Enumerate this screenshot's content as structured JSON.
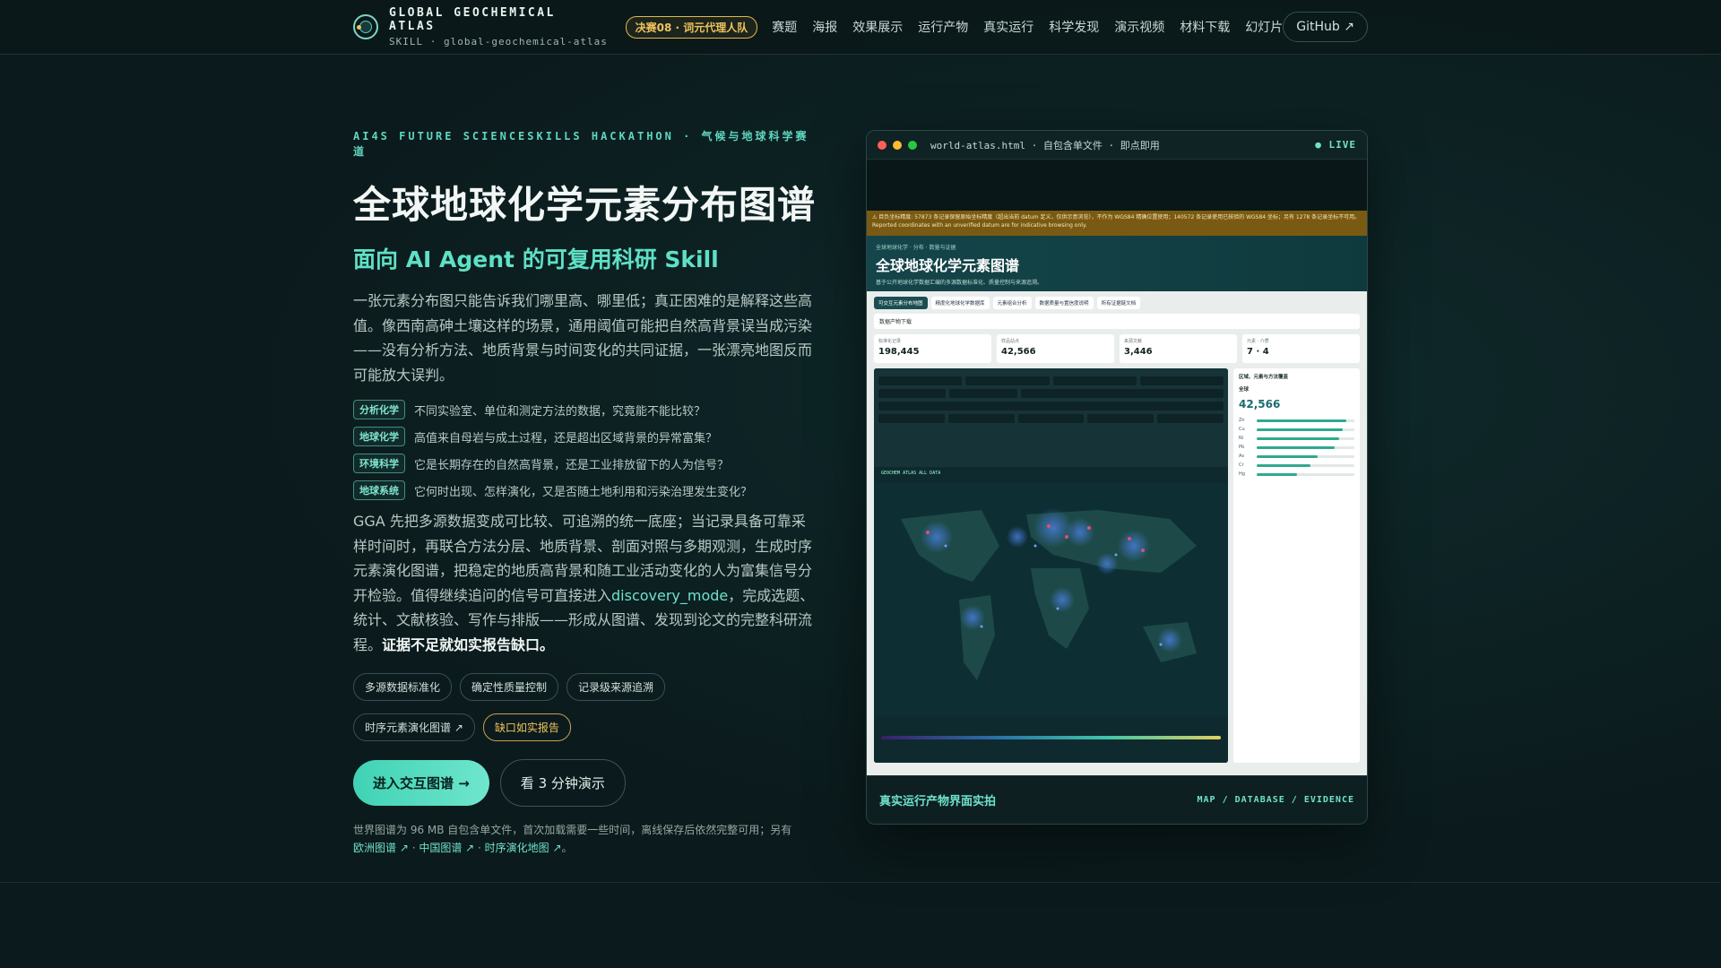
{
  "nav": {
    "brand_title": "GLOBAL GEOCHEMICAL ATLAS",
    "brand_sub": "SKILL · global-geochemical-atlas",
    "badge": "决赛08 · 词元代理人队",
    "links": [
      "赛题",
      "海报",
      "效果展示",
      "运行产物",
      "真实运行",
      "科学发现",
      "演示视频",
      "材料下载",
      "幻灯片"
    ],
    "github": "GitHub ↗"
  },
  "hero": {
    "eyebrow": "AI4S FUTURE SCIENCESKILLS HACKATHON · 气候与地球科学赛道",
    "title": "全球地球化学元素分布图谱",
    "subtitle": "面向 AI Agent 的可复用科研 Skill",
    "intro": "一张元素分布图只能告诉我们哪里高、哪里低；真正困难的是解释这些高值。像西南高砷土壤这样的场景，通用阈值可能把自然高背景误当成污染——没有分析方法、地质背景与时间变化的共同证据，一张漂亮地图反而可能放大误判。",
    "questions": [
      {
        "tag": "分析化学",
        "text": "不同实验室、单位和测定方法的数据，究竟能不能比较？"
      },
      {
        "tag": "地球化学",
        "text": "高值来自母岩与成土过程，还是超出区域背景的异常富集？"
      },
      {
        "tag": "环境科学",
        "text": "它是长期存在的自然高背景，还是工业排放留下的人为信号？"
      },
      {
        "tag": "地球系统",
        "text": "它何时出现、怎样演化，又是否随土地利用和污染治理发生变化？"
      }
    ],
    "body_part1": "GGA 先把多源数据变成可比较、可追溯的统一底座；当记录具备可靠采样时间时，再联合方法分层、地质背景、剖面对照与多期观测，生成时序元素演化图谱，把稳定的地质高背景和随工业活动变化的人为富集信号分开检验。值得继续追问的信号可直接进入",
    "body_accent": "discovery_mode",
    "body_part2": "，完成选题、统计、文献核验、写作与排版——形成从图谱、发现到论文的完整科研流程。",
    "body_strong": "证据不足就如实报告缺口。",
    "chips": [
      "多源数据标准化",
      "确定性质量控制",
      "记录级来源追溯"
    ],
    "chips2": [
      "时序元素演化图谱 ↗",
      "缺口如实报告"
    ],
    "cta_primary": "进入交互图谱 →",
    "cta_secondary": "看 3 分钟演示",
    "note_text": "世界图谱为 96 MB 自包含单文件，首次加载需要一些时间，离线保存后依然完整可用；另有",
    "note_links": [
      "欧洲图谱 ↗",
      "中国图谱 ↗",
      "时序演化地图 ↗"
    ],
    "note_sep": " · ",
    "note_end": "。"
  },
  "window": {
    "file": "world-atlas.html · 自包含单文件 · 即点即用",
    "live": "● LIVE",
    "caption": "真实运行产物界面实拍",
    "tags": "MAP / DATABASE / EVIDENCE",
    "colors": {
      "red": "#ff5f57",
      "yellow": "#febc2e",
      "green": "#28c840"
    }
  },
  "screen": {
    "warning": "⚠ 目负坐标精度: 57873 条记录保留原始坐标精度（超出当前 datum 定义，仅供示意浏览），不作为 WGS84 精确位置使用；140572 条记录使用已核验的 WGS84 坐标；另有 1278 条记录坐标不可用。Reported coordinates with an unverified datum are for indicative browsing only.",
    "app_eyebrow": "全球地球化学 · 分布 · 数量与证据",
    "app_title": "全球地球化学元素图谱",
    "app_desc": "基于公开地球化学数据汇编的多源数据标准化、质量控制与来源追溯。",
    "tabs": [
      "可交互元素分布地图",
      "精度化地球化学数据库",
      "元素组合分析",
      "数据质量与置信度说明",
      "所有证据链文档"
    ],
    "crumb": "数据产物下载",
    "stats": [
      {
        "label": "标准化记录",
        "value": "198,445"
      },
      {
        "label": "样品站点",
        "value": "42,566"
      },
      {
        "label": "来源文献",
        "value": "3,446"
      },
      {
        "label": "元素 · 介质",
        "value": "7 · 4"
      }
    ],
    "side_title": "区域、元素与方法覆盖",
    "side_scope": "全球",
    "side_value": "42,566",
    "side_bars": [
      {
        "el": "Zn",
        "pct": 0.92
      },
      {
        "el": "Cu",
        "pct": 0.88
      },
      {
        "el": "Ni",
        "pct": 0.84
      },
      {
        "el": "Pb",
        "pct": 0.8
      },
      {
        "el": "As",
        "pct": 0.62
      },
      {
        "el": "Cr",
        "pct": 0.55
      },
      {
        "el": "Hg",
        "pct": 0.41
      }
    ],
    "map_label": "GEOCHEM ATLAS ALL DATA"
  }
}
